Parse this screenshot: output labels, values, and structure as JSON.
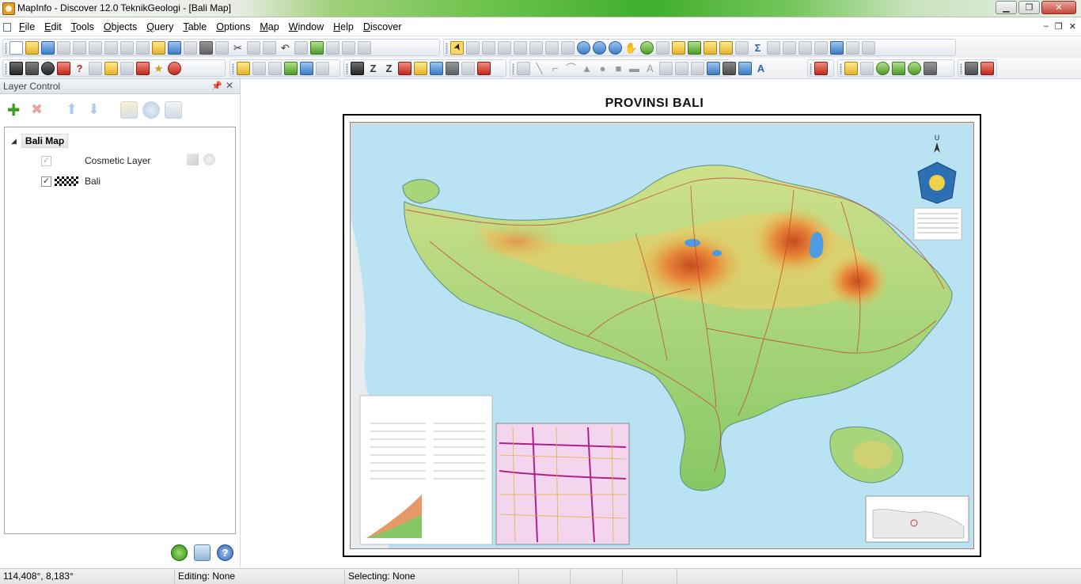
{
  "window": {
    "title": "MapInfo - Discover 12.0    TeknikGeologi - [Bali Map]",
    "min_glyph": "▁",
    "max_glyph": "❐",
    "close_glyph": "✕"
  },
  "menubar": {
    "items": [
      {
        "key": "F",
        "rest": "ile"
      },
      {
        "key": "E",
        "rest": "dit"
      },
      {
        "key": "T",
        "rest": "ools"
      },
      {
        "key": "O",
        "rest": "bjects"
      },
      {
        "key": "Q",
        "rest": "uery"
      },
      {
        "key": "T",
        "rest": "able"
      },
      {
        "key": "O",
        "rest": "ptions"
      },
      {
        "key": "M",
        "rest": "ap"
      },
      {
        "key": "W",
        "rest": "indow"
      },
      {
        "key": "H",
        "rest": "elp"
      },
      {
        "key": "D",
        "rest": "iscover"
      }
    ],
    "mdi_min": "–",
    "mdi_restore": "❐",
    "mdi_close": "✕"
  },
  "layer_control": {
    "title": "Layer Control",
    "pin_glyph": "📌",
    "close_glyph": "✕",
    "root": "Bali Map",
    "expander_glyph": "◢",
    "layers": [
      {
        "name": "Cosmetic Layer",
        "checked": "✓"
      },
      {
        "name": "Bali",
        "checked": "✓"
      }
    ],
    "help_glyph": "?"
  },
  "map": {
    "title": "PROVINSI  BALI",
    "north_label": "U"
  },
  "statusbar": {
    "coords": "114,408°, 8,183°",
    "editing": "Editing: None",
    "selecting": "Selecting: None"
  },
  "colors": {
    "sea": "#b9e3f3",
    "lowland": "#8fcf6b",
    "highland": "#e9c25a",
    "peak": "#d8622a",
    "lake": "#4d9be0"
  }
}
